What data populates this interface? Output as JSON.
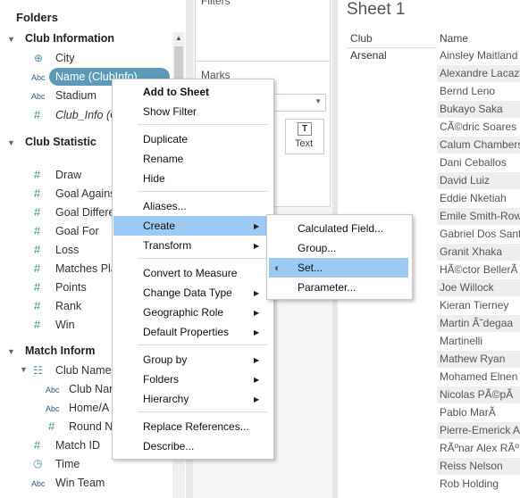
{
  "data_pane": {
    "title": "Folders",
    "groups": [
      {
        "label": "Club Information"
      },
      {
        "label": "Club Statistic"
      },
      {
        "label": "Match Inform"
      }
    ],
    "fields": {
      "city": "City",
      "name": "Name (ClubInfo)",
      "stadium": "Stadium",
      "club_info": "Club_Info (C",
      "draw": "Draw",
      "goal_against": "Goal Agains",
      "goal_diff": "Goal Differe",
      "goal_for": "Goal For",
      "loss": "Loss",
      "matches_played": "Matches Pla",
      "points": "Points",
      "rank": "Rank",
      "win": "Win",
      "club_name_hier": "Club Name,",
      "club_name": "Club Nar",
      "home_away": "Home/A",
      "round": "Round N",
      "match_id": "Match ID",
      "time": "Time",
      "win_team": "Win Team"
    },
    "icons": {
      "abc": "Abc",
      "hash": "#",
      "globe": "⊕",
      "hier": "☷",
      "cal": "◷"
    }
  },
  "middle": {
    "filters_label": "Filters",
    "marks_label": "Marks",
    "text_label": "Text",
    "text_icon": "T"
  },
  "sheet": {
    "title": "Sheet 1",
    "columns": [
      "Club",
      "Name"
    ],
    "club_value": "Arsenal",
    "names": [
      "Ainsley Maitland",
      "Alexandre Lacaz",
      "Bernd Leno",
      "Bukayo Saka",
      "CÃ©dric Soares",
      "Calum Chambers",
      "Dani Ceballos",
      "David Luiz",
      "Eddie Nketiah",
      "Emile Smith-Row",
      "Gabriel Dos Sant",
      "Granit Xhaka",
      "HÃ©ctor BellerÃ",
      "Joe Willock",
      "Kieran Tierney",
      "Martin Ã˜degaa",
      "Martinelli",
      "Mathew Ryan",
      "Mohamed Elnen",
      "Nicolas PÃ©pÃ",
      "Pablo MarÃ",
      "Pierre-Emerick A",
      "RÃºnar Alex RÃº",
      "Reiss Nelson",
      "Rob Holding"
    ]
  },
  "context_menu": {
    "items": {
      "add_to_sheet": "Add to Sheet",
      "show_filter": "Show Filter",
      "duplicate": "Duplicate",
      "rename": "Rename",
      "hide": "Hide",
      "aliases": "Aliases...",
      "create": "Create",
      "transform": "Transform",
      "convert": "Convert to Measure",
      "change_type": "Change Data Type",
      "geo_role": "Geographic Role",
      "default_props": "Default Properties",
      "group_by": "Group by",
      "folders": "Folders",
      "hierarchy": "Hierarchy",
      "replace_refs": "Replace References...",
      "describe": "Describe..."
    }
  },
  "submenu": {
    "calculated": "Calculated Field...",
    "group": "Group...",
    "set": "Set...",
    "parameter": "Parameter..."
  },
  "colors": {
    "selection": "#5b9bb8",
    "menu_highlight": "#9ccaf4"
  }
}
